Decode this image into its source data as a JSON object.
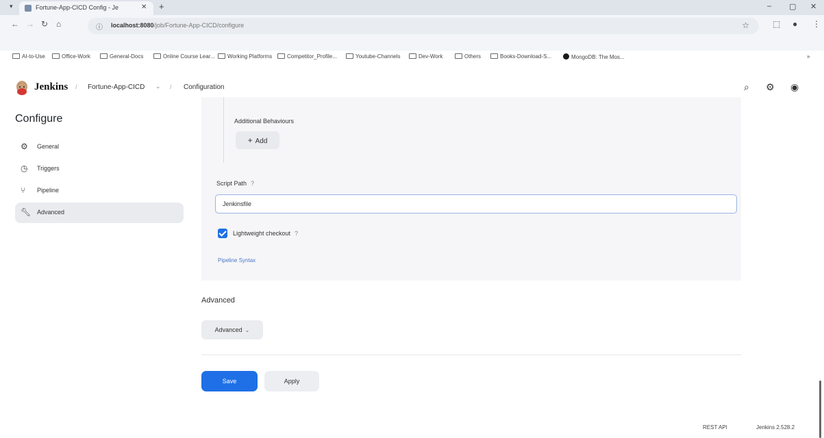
{
  "browser": {
    "tab_title": "Fortune-App-CICD Config - Je",
    "url_host": "localhost:8080",
    "url_path": "/job/Fortune-App-CICD/configure",
    "bookmarks": [
      "AI-to-Use",
      "Office-Work",
      "General-Docs",
      "Online Course Lear...",
      "Working Platforms",
      "Competitor_Profile...",
      "Youtube-Channels",
      "Dev-Work",
      "Others",
      "Books-Download-S...",
      "MongoDB: The Mos..."
    ]
  },
  "header": {
    "app_name": "Jenkins",
    "breadcrumb_job": "Fortune-App-CICD",
    "breadcrumb_page": "Configuration"
  },
  "sidebar": {
    "title": "Configure",
    "items": [
      {
        "label": "General",
        "icon": "gear-icon"
      },
      {
        "label": "Triggers",
        "icon": "clock-icon"
      },
      {
        "label": "Pipeline",
        "icon": "pipeline-icon"
      },
      {
        "label": "Advanced",
        "icon": "wrench-icon"
      }
    ],
    "active_index": 3
  },
  "pipeline": {
    "additional_behaviours_label": "Additional Behaviours",
    "add_label": "Add",
    "script_path_label": "Script Path",
    "help": "?",
    "script_path_value": "Jenkinsfile",
    "lightweight_checkout_label": "Lightweight checkout",
    "lightweight_checkout_checked": true,
    "pipeline_syntax_link": "Pipeline Syntax"
  },
  "advanced": {
    "title": "Advanced",
    "button_label": "Advanced"
  },
  "actions": {
    "save_label": "Save",
    "apply_label": "Apply"
  },
  "footer": {
    "rest_api": "REST API",
    "version": "Jenkins 2.528.2"
  },
  "colors": {
    "primary": "#1f70e6",
    "link": "#4a78c8"
  }
}
